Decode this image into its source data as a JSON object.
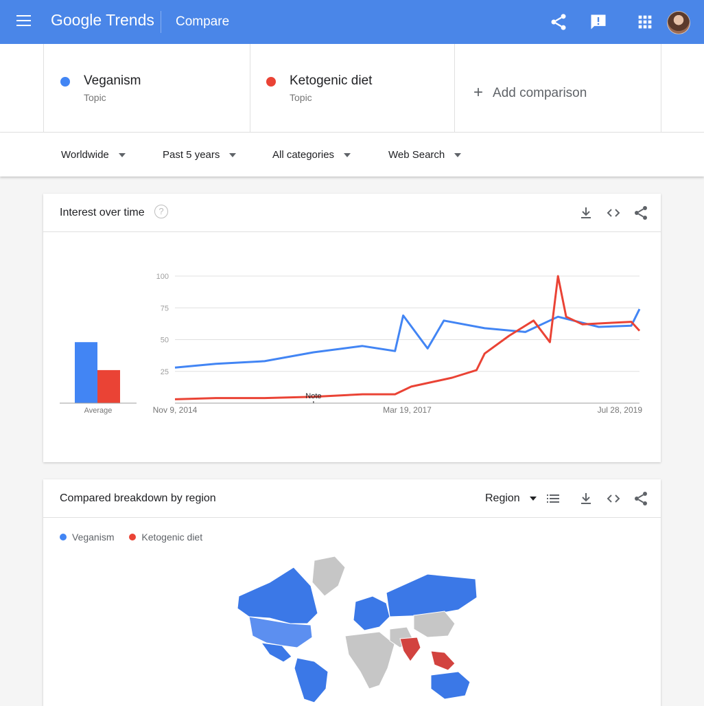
{
  "header": {
    "brand_google": "Google",
    "brand_trends": "Trends",
    "page": "Compare"
  },
  "terms": [
    {
      "name": "Veganism",
      "type": "Topic",
      "color": "#4285f4"
    },
    {
      "name": "Ketogenic diet",
      "type": "Topic",
      "color": "#ea4335"
    }
  ],
  "add_comparison": "Add comparison",
  "filters": {
    "geo": "Worldwide",
    "time": "Past 5 years",
    "category": "All categories",
    "property": "Web Search"
  },
  "interest_card": {
    "title": "Interest over time",
    "help": "?",
    "average_label": "Average",
    "note": "Note"
  },
  "region_card": {
    "title": "Compared breakdown by region",
    "region_select": "Region"
  },
  "chart_data": {
    "type": "line",
    "ylim": [
      0,
      100
    ],
    "yticks": [
      "100",
      "75",
      "50",
      "25"
    ],
    "xlabels": [
      "Nov 9, 2014",
      "Mar 19, 2017",
      "Jul 28, 2019"
    ],
    "average": {
      "Veganism": 48,
      "Ketogenic diet": 26
    },
    "series": [
      {
        "name": "Veganism",
        "color": "#4285f4",
        "x_dates": [
          "2014-11",
          "2015-04",
          "2015-10",
          "2016-04",
          "2016-10",
          "2017-02",
          "2017-03",
          "2017-06",
          "2017-08",
          "2018-01",
          "2018-06",
          "2018-10",
          "2019-03",
          "2019-07",
          "2019-08"
        ],
        "values": [
          28,
          31,
          33,
          40,
          45,
          41,
          69,
          43,
          65,
          59,
          56,
          68,
          60,
          61,
          74
        ]
      },
      {
        "name": "Ketogenic diet",
        "color": "#ea4335",
        "x_dates": [
          "2014-11",
          "2015-04",
          "2015-10",
          "2016-04",
          "2016-10",
          "2017-02",
          "2017-04",
          "2017-09",
          "2017-12",
          "2018-01",
          "2018-04",
          "2018-07",
          "2018-09",
          "2018-10",
          "2018-11",
          "2019-01",
          "2019-04",
          "2019-07",
          "2019-08"
        ],
        "values": [
          3,
          4,
          4,
          5,
          7,
          7,
          13,
          20,
          26,
          39,
          53,
          65,
          48,
          100,
          68,
          62,
          63,
          64,
          57
        ]
      }
    ]
  },
  "map_legend": [
    {
      "name": "Veganism",
      "color": "#4285f4"
    },
    {
      "name": "Ketogenic diet",
      "color": "#ea4335"
    }
  ]
}
